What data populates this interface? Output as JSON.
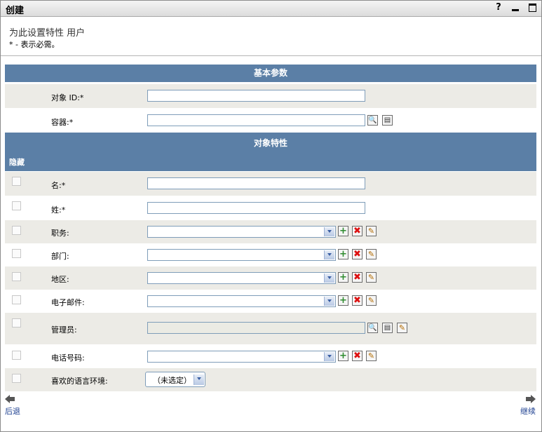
{
  "window": {
    "title": "创建",
    "help_icon": "?",
    "minimize_icon": "minimize-icon",
    "maximize_icon": "maximize-icon"
  },
  "intro": {
    "text": "为此设置特性 用户",
    "required_note": "* - 表示必需。"
  },
  "sections": {
    "basic": "基本参数",
    "attributes": "对象特性",
    "hide_column": "隐藏"
  },
  "basic_fields": {
    "object_id": {
      "label": "对象 ID:*",
      "value": ""
    },
    "container": {
      "label": "容器:*",
      "value": ""
    }
  },
  "attributes": {
    "given_name": {
      "label": "名:*",
      "value": ""
    },
    "surname": {
      "label": "姓:*",
      "value": ""
    },
    "title": {
      "label": "职务:",
      "value": ""
    },
    "department": {
      "label": "部门:",
      "value": ""
    },
    "location": {
      "label": "地区:",
      "value": ""
    },
    "email": {
      "label": "电子邮件:",
      "value": ""
    },
    "manager": {
      "label": "管理员:",
      "value": ""
    },
    "phone": {
      "label": "电话号码:",
      "value": ""
    },
    "locale": {
      "label": "喜欢的语言环境:",
      "value": "（未选定）"
    }
  },
  "nav": {
    "back": "后退",
    "next": "继续"
  },
  "colors": {
    "section_header": "#5b7fa6",
    "row_alt": "#ecebe6",
    "link": "#1a3d8f"
  }
}
